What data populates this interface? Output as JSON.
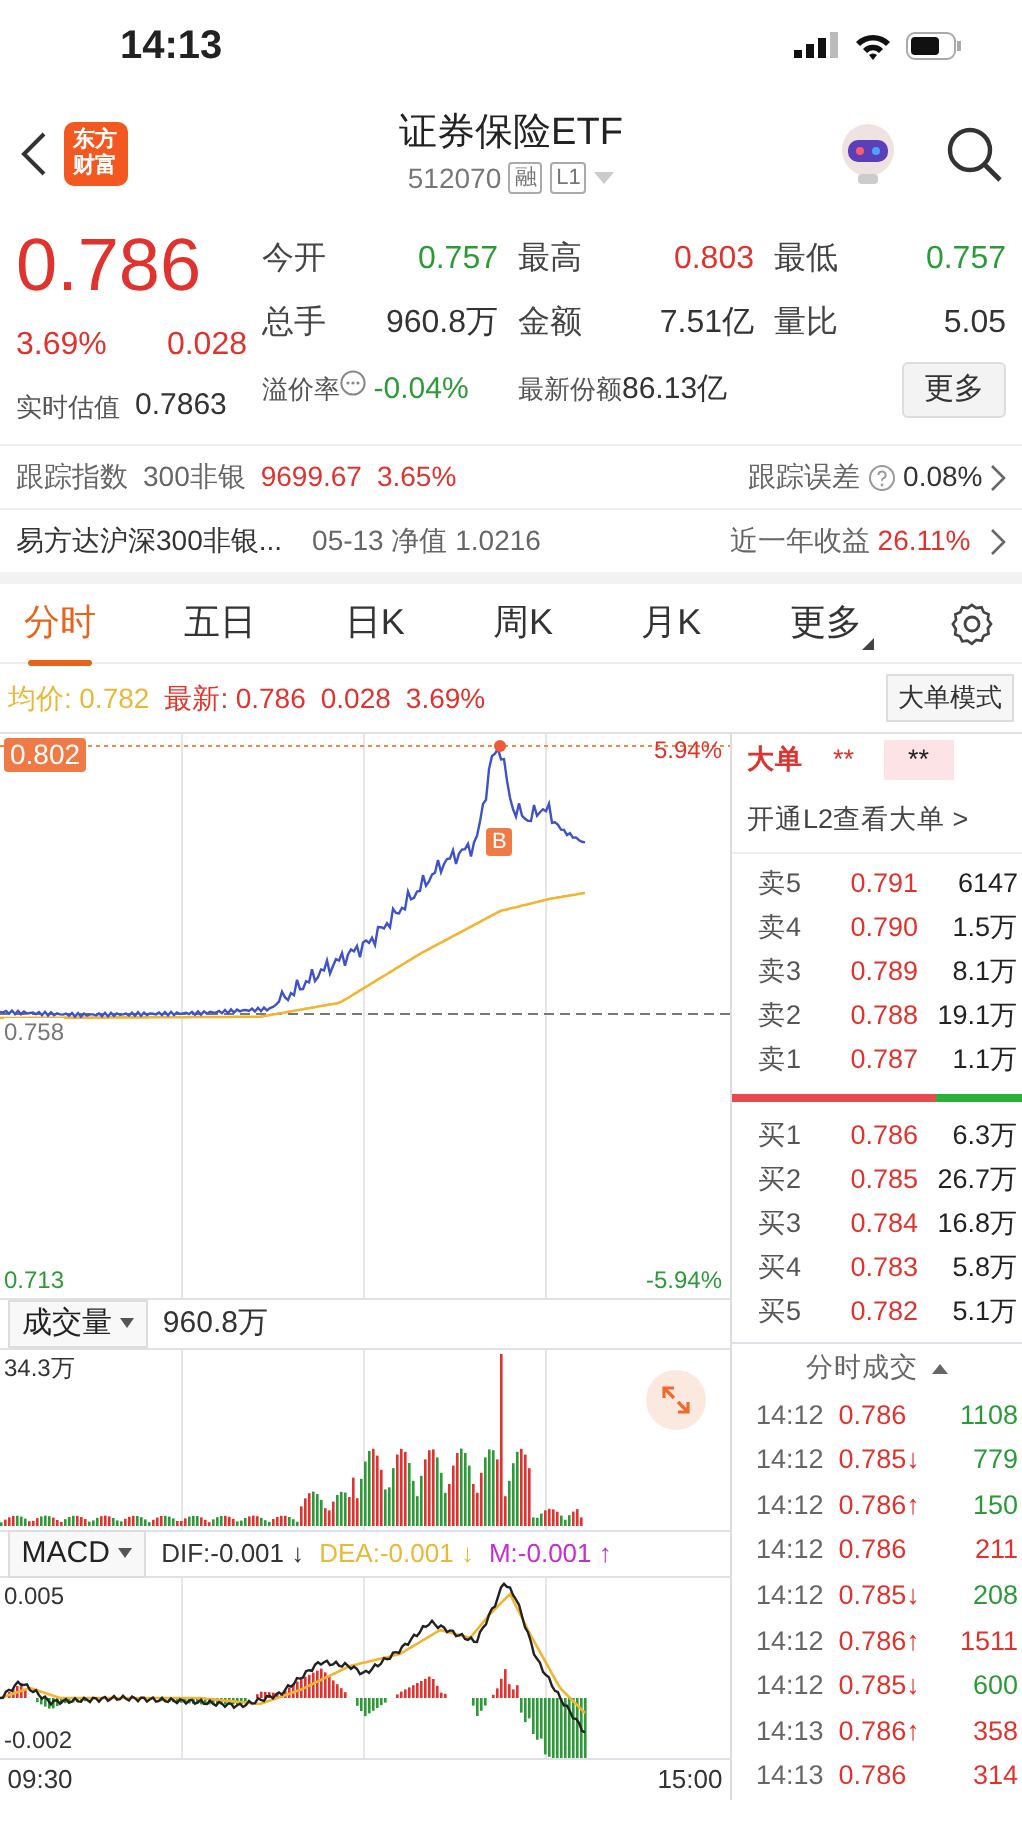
{
  "status_bar": {
    "time": "14:13"
  },
  "header": {
    "logo": [
      "东方",
      "财富"
    ],
    "title": "证券保险ETF",
    "code": "512070",
    "badges": [
      "融",
      "L1"
    ]
  },
  "quote": {
    "price": "0.786",
    "change_pct": "3.69%",
    "change": "0.028",
    "color": "#e0332e",
    "stats": [
      {
        "label": "今开",
        "value": "0.757",
        "color": "#2b9a37"
      },
      {
        "label": "最高",
        "value": "0.803",
        "color": "#e0332e"
      },
      {
        "label": "最低",
        "value": "0.757",
        "color": "#2b9a37"
      },
      {
        "label": "总手",
        "value": "960.8万",
        "color": "#333333"
      },
      {
        "label": "金额",
        "value": "7.51亿",
        "color": "#333333"
      },
      {
        "label": "量比",
        "value": "5.05",
        "color": "#333333"
      }
    ],
    "estimate": {
      "label": "实时估值",
      "value": "0.7863"
    },
    "premium": {
      "label": "溢价率",
      "value": "-0.04%",
      "color": "#2b9a37"
    },
    "shares": {
      "label": "最新份额",
      "value": "86.13亿"
    },
    "more_button": "更多"
  },
  "tracking": {
    "label": "跟踪指数",
    "index": "300非银",
    "value": "9699.67",
    "pct": "3.65%",
    "error_label": "跟踪误差",
    "error_value": "0.08%"
  },
  "fund": {
    "name": "易方达沪深300非银...",
    "nav": "05-13 净值 1.0216",
    "return_label": "近一年收益",
    "return_value": "26.11%"
  },
  "tabs": [
    {
      "label": "分时",
      "selected": true
    },
    {
      "label": "五日",
      "selected": false
    },
    {
      "label": "日K",
      "selected": false
    },
    {
      "label": "周K",
      "selected": false
    },
    {
      "label": "月K",
      "selected": false
    },
    {
      "label": "更多",
      "selected": false,
      "kind": "dropdown"
    }
  ],
  "chart_info": {
    "avg_label": "均价:",
    "avg": "0.782",
    "latest_label": "最新:",
    "latest": "0.786",
    "change": "0.028",
    "pct": "3.69%",
    "mode_button": "大单模式"
  },
  "price_chart": {
    "max": "0.802",
    "min": "0.713",
    "ref": "0.758",
    "max_pct": "5.94%",
    "min_pct": "-5.94%",
    "marker": "B"
  },
  "order_book": {
    "big_label": "大单",
    "big_values": [
      "**",
      "**"
    ],
    "l2_link": "开通L2查看大单 >",
    "asks": [
      {
        "label": "卖5",
        "price": "0.791",
        "volume": "6147"
      },
      {
        "label": "卖4",
        "price": "0.790",
        "volume": "1.5万"
      },
      {
        "label": "卖3",
        "price": "0.789",
        "volume": "8.1万"
      },
      {
        "label": "卖2",
        "price": "0.788",
        "volume": "19.1万"
      },
      {
        "label": "卖1",
        "price": "0.787",
        "volume": "1.1万"
      }
    ],
    "ratio": {
      "level": 0.7
    },
    "bids": [
      {
        "label": "买1",
        "price": "0.786",
        "volume": "6.3万"
      },
      {
        "label": "买2",
        "price": "0.785",
        "volume": "26.7万"
      },
      {
        "label": "买3",
        "price": "0.784",
        "volume": "16.8万"
      },
      {
        "label": "买4",
        "price": "0.783",
        "volume": "5.8万"
      },
      {
        "label": "买5",
        "price": "0.782",
        "volume": "5.1万"
      }
    ]
  },
  "volume": {
    "selector": "成交量",
    "total": "960.8万",
    "max": "34.3万"
  },
  "macd": {
    "selector": "MACD",
    "dif": "DIF:-0.001 ↓",
    "dea": "DEA:-0.001 ↓",
    "m": "M:-0.001 ↑",
    "max": "0.005",
    "min": "-0.002"
  },
  "time_axis": [
    "09:30",
    "15:00"
  ],
  "trades": {
    "title": "分时成交",
    "rows": [
      {
        "time": "14:12",
        "price": "0.786",
        "volume": "1108",
        "color": "#2b9a37"
      },
      {
        "time": "14:12",
        "price": "0.785",
        "arrow": "↓",
        "volume": "779",
        "color": "#2b9a37"
      },
      {
        "time": "14:12",
        "price": "0.786",
        "arrow": "↑",
        "volume": "150",
        "color": "#2b9a37"
      },
      {
        "time": "14:12",
        "price": "0.786",
        "volume": "211",
        "color": "#e0332e"
      },
      {
        "time": "14:12",
        "price": "0.785",
        "arrow": "↓",
        "volume": "208",
        "color": "#2b9a37"
      },
      {
        "time": "14:12",
        "price": "0.786",
        "arrow": "↑",
        "volume": "1511",
        "color": "#e0332e"
      },
      {
        "time": "14:12",
        "price": "0.785",
        "arrow": "↓",
        "volume": "600",
        "color": "#2b9a37"
      },
      {
        "time": "14:13",
        "price": "0.786",
        "arrow": "↑",
        "volume": "358",
        "color": "#e0332e"
      },
      {
        "time": "14:13",
        "price": "0.786",
        "volume": "314",
        "color": "#e0332e"
      }
    ]
  }
}
